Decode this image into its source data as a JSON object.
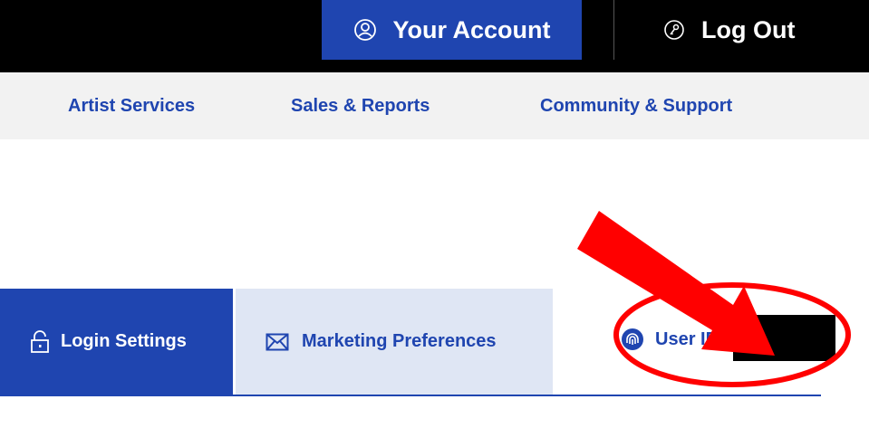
{
  "header": {
    "account_label": "Your Account",
    "logout_label": "Log Out",
    "account_icon": "user-circle-icon",
    "logout_icon": "key-icon"
  },
  "nav": {
    "items": [
      {
        "label": "Artist Services"
      },
      {
        "label": "Sales & Reports"
      },
      {
        "label": "Community & Support"
      }
    ]
  },
  "tabs": [
    {
      "label": "Login Settings",
      "icon": "lock-icon",
      "active": true
    },
    {
      "label": "Marketing Preferences",
      "icon": "envelope-icon",
      "active": false
    },
    {
      "label": "User ID",
      "icon": "fingerprint-icon",
      "active": false
    }
  ],
  "colors": {
    "brand_blue": "#1f45b0",
    "light_tab": "#dfe6f4",
    "annotation_red": "#ff0000"
  }
}
